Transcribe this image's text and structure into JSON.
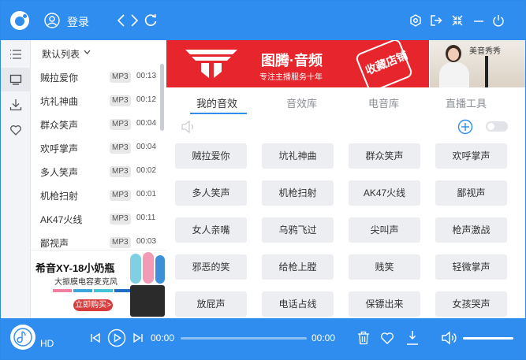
{
  "titlebar": {
    "login_label": "登录",
    "icons": [
      "app-logo-icon",
      "user-icon",
      "back-icon",
      "forward-icon",
      "refresh-icon",
      "settings-icon",
      "exit-icon",
      "mini-mode-icon",
      "minimize-icon",
      "power-icon"
    ]
  },
  "iconbar": {
    "items": [
      "list-icon",
      "monitor-icon",
      "download-icon",
      "heart-icon"
    ],
    "active": "monitor-icon"
  },
  "playlist": {
    "header": "默认列表",
    "tracks": [
      {
        "name": "贼拉爱你",
        "format": "MP3",
        "time": "00:13"
      },
      {
        "name": "坑礼神曲",
        "format": "MP3",
        "time": "00:12"
      },
      {
        "name": "群众笑声",
        "format": "MP3",
        "time": "00:04"
      },
      {
        "name": "欢呼掌声",
        "format": "MP3",
        "time": "00:04"
      },
      {
        "name": "多人笑声",
        "format": "MP3",
        "time": "00:02"
      },
      {
        "name": "机枪扫射",
        "format": "MP3",
        "time": "00:01"
      },
      {
        "name": "AK47火线",
        "format": "MP3",
        "time": "00:11"
      },
      {
        "name": "鄙视声",
        "format": "MP3",
        "time": "00:03"
      }
    ]
  },
  "side_ad": {
    "title": "希音XY-18小奶瓶",
    "subtitle": "大振膜电容麦克风",
    "button": "立即购买>",
    "swatch_colors": [
      "#f07fa0",
      "#3aa7de",
      "#44c2d6",
      "#1e6fc4"
    ]
  },
  "banner": {
    "title": "图腾·音频",
    "subtitle": "专注主播服务十年",
    "stamp": "收藏店铺",
    "side_label": "美音秀秀",
    "brand_color": "#e6262c"
  },
  "tabs": [
    {
      "label": "我的音效",
      "active": true
    },
    {
      "label": "音效库",
      "active": false
    },
    {
      "label": "电音库",
      "active": false
    },
    {
      "label": "直播工具",
      "active": false
    }
  ],
  "sounds": [
    "贼拉爱你",
    "坑礼神曲",
    "群众笑声",
    "欢呼掌声",
    "多人笑声",
    "机枪扫射",
    "AK47火线",
    "鄙视声",
    "女人亲嘴",
    "乌鸦飞过",
    "尖叫声",
    "枪声激战",
    "邪恶的笑",
    "给枪上膛",
    "贱笑",
    "轻微掌声",
    "放屁声",
    "电话占线",
    "保镖出来",
    "女孩哭声"
  ],
  "player": {
    "quality": "HD",
    "current_time": "00:00",
    "total_time": "00:00",
    "progress": 0,
    "volume": 1.0,
    "accent": "#2f8df0"
  }
}
